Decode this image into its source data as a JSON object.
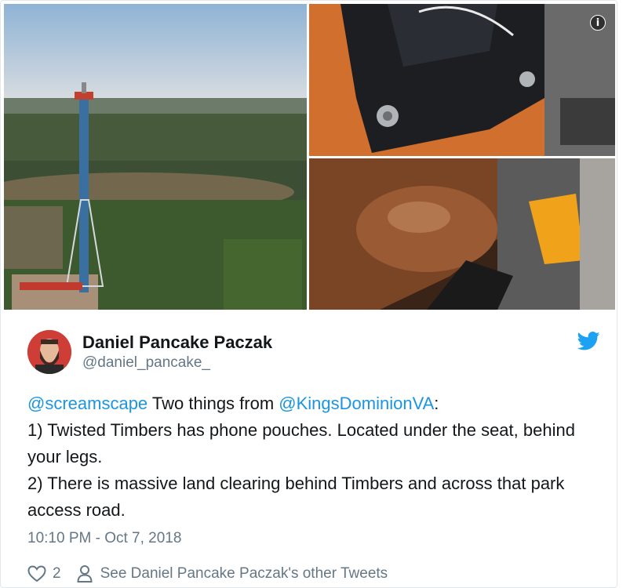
{
  "media": {
    "info_icon": "info-icon",
    "images": [
      "amusement-park-drop-tower-aerial",
      "phone-pouch-on-seat",
      "coaster-seat-closeup"
    ]
  },
  "user": {
    "name": "Daniel Pancake Paczak",
    "handle": "@daniel_pancake_"
  },
  "tweet": {
    "mention1": "@screamscape",
    "text1": " Two things from ",
    "mention2": "@KingsDominionVA",
    "text2": ":\n1) Twisted Timbers has phone pouches. Located under the seat, behind your legs.\n2) There is massive land clearing behind Timbers and across that park access road."
  },
  "timestamp": "10:10 PM - Oct 7, 2018",
  "actions": {
    "like_count": "2",
    "other_tweets_label": "See Daniel Pancake Paczak's other Tweets"
  },
  "colors": {
    "mention": "#1b95e0",
    "twitter_blue": "#1da1f2",
    "muted": "#657786"
  }
}
